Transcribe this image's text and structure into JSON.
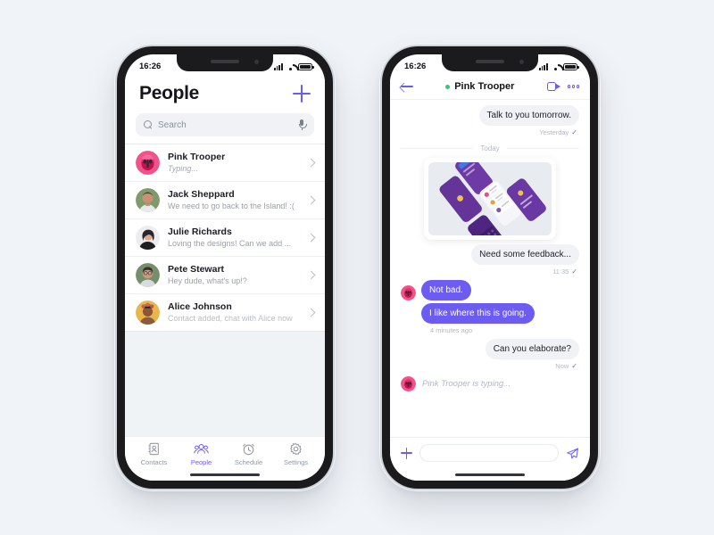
{
  "page": {
    "background": "#F0F3F7",
    "accent": "#6B5CF0",
    "bubble_in": "#6C5CF2",
    "bubble_out": "#F0F2F6",
    "online_green": "#2ECC71"
  },
  "people_screen": {
    "status_bar": {
      "time": "16:26",
      "signal_icon": "signal-bars-icon",
      "wifi_icon": "wifi-icon",
      "battery_icon": "battery-icon"
    },
    "title": "People",
    "add_label": "+",
    "search": {
      "placeholder": "Search",
      "value": "",
      "search_icon": "search-icon",
      "mic_icon": "microphone-icon"
    },
    "contacts": [
      {
        "name": "Pink Trooper",
        "message": "Typing...",
        "style": "typing",
        "avatar": "pink-trooper-avatar"
      },
      {
        "name": "Jack Sheppard",
        "message": "We need to go back to the Island! :(",
        "style": "normal",
        "avatar": "jack-sheppard-avatar"
      },
      {
        "name": "Julie Richards",
        "message": "Loving the designs! Can we add ...",
        "style": "normal",
        "avatar": "julie-richards-avatar"
      },
      {
        "name": "Pete Stewart",
        "message": "Hey dude, what's up!?",
        "style": "normal",
        "avatar": "pete-stewart-avatar"
      },
      {
        "name": "Alice Johnson",
        "message": "Contact added, chat with Alice now",
        "style": "muted",
        "avatar": "alice-johnson-avatar"
      }
    ],
    "tabs": [
      {
        "label": "Contacts",
        "icon": "contacts-icon",
        "active": false
      },
      {
        "label": "People",
        "icon": "people-icon",
        "active": true
      },
      {
        "label": "Schedule",
        "icon": "clock-icon",
        "active": false
      },
      {
        "label": "Settings",
        "icon": "gear-icon",
        "active": false
      }
    ]
  },
  "chat_screen": {
    "status_bar": {
      "time": "16:26",
      "signal_icon": "signal-bars-icon",
      "wifi_icon": "wifi-icon",
      "battery_icon": "battery-icon"
    },
    "header": {
      "back_icon": "back-arrow-icon",
      "online": true,
      "title": "Pink Trooper",
      "video_icon": "video-camera-icon",
      "more_icon": "more-options-icon"
    },
    "messages": [
      {
        "type": "text",
        "side": "out",
        "text": "Talk to you tomorrow.",
        "meta": "Yesterday",
        "ticked": true
      },
      {
        "type": "day",
        "text": "Today"
      },
      {
        "type": "image",
        "side": "out",
        "alt": "purple-app-mockups-image"
      },
      {
        "type": "text",
        "side": "out",
        "text": "Need some feedback...",
        "meta": "11:35",
        "ticked": true
      },
      {
        "type": "text",
        "side": "in",
        "text": "Not bad.",
        "avatar": "pink-trooper-avatar"
      },
      {
        "type": "text",
        "side": "in",
        "text": "I like where this is going.",
        "meta": "4 minutes ago"
      },
      {
        "type": "text",
        "side": "out",
        "text": "Can you elaborate?",
        "meta": "Now",
        "ticked": true
      }
    ],
    "typing_indicator": {
      "text": "Pink Trooper is typing...",
      "avatar": "pink-trooper-avatar"
    },
    "input": {
      "placeholder": "",
      "value": "",
      "attach_icon": "plus-icon",
      "send_icon": "send-paper-plane-icon"
    }
  }
}
